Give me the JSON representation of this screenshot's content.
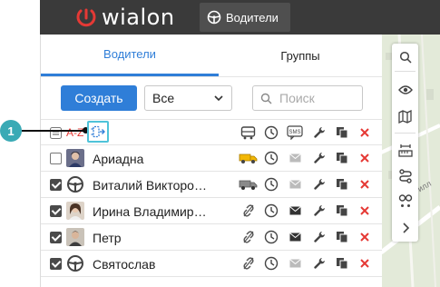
{
  "app": {
    "logo_text": "wialon",
    "active_module": "Водители"
  },
  "tabs": [
    {
      "label": "Водители",
      "active": true
    },
    {
      "label": "Группы",
      "active": false
    }
  ],
  "toolbar": {
    "create_label": "Создать",
    "filter_value": "Все",
    "search_placeholder": "Поиск"
  },
  "header": {
    "sort_label": "А-Z"
  },
  "callout": {
    "number": "1"
  },
  "drivers": [
    {
      "name": "Ариадна",
      "checked": false,
      "vehicle": "truck-yellow",
      "message": "envelope-gray"
    },
    {
      "name": "Виталий Викторо…",
      "checked": true,
      "vehicle": "truck-gray",
      "message": "envelope-gray"
    },
    {
      "name": "Ирина Владимир…",
      "checked": true,
      "vehicle": "unlink",
      "message": "envelope-dark"
    },
    {
      "name": "Петр",
      "checked": true,
      "vehicle": "unlink",
      "message": "envelope-dark"
    },
    {
      "name": "Святослав",
      "checked": true,
      "vehicle": "unlink",
      "message": "envelope-gray"
    }
  ],
  "map_overlay": {
    "road_label": "илл"
  },
  "colors": {
    "accent": "#2f7ed8",
    "callout": "#3aaab5",
    "delete": "#e53935",
    "topbar": "#3a3a3a"
  }
}
